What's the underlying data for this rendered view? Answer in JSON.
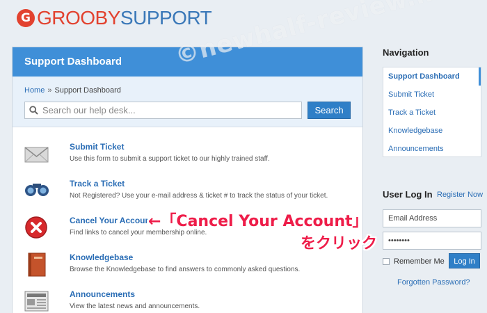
{
  "logo": {
    "grooby": "GROOBY",
    "support": "SUPPORT"
  },
  "watermark": "©newhalf-review.info",
  "panel": {
    "title": "Support Dashboard",
    "breadcrumb": {
      "home": "Home",
      "separator": "»",
      "current": "Support Dashboard"
    },
    "search": {
      "placeholder": "Search our help desk...",
      "button": "Search"
    }
  },
  "items": [
    {
      "title": "Submit Ticket",
      "desc": "Use this form to submit a support ticket to our highly trained staff.",
      "icon": "envelope-icon"
    },
    {
      "title": "Track a Ticket",
      "desc": "Not Registered? Use your e-mail address & ticket # to track the status of your ticket.",
      "icon": "binoculars-icon"
    },
    {
      "title": "Cancel Your Account",
      "desc": "Find links to cancel your membership online.",
      "icon": "cancel-icon"
    },
    {
      "title": "Knowledgebase",
      "desc": "Browse the Knowledgebase to find answers to commonly asked questions.",
      "icon": "book-icon"
    },
    {
      "title": "Announcements",
      "desc": "View the latest news and announcements.",
      "icon": "newspaper-icon"
    }
  ],
  "annotation": {
    "line1": "←「Cancel Your Account」",
    "line2": "をクリック"
  },
  "navigation": {
    "heading": "Navigation",
    "items": [
      "Support Dashboard",
      "Submit Ticket",
      "Track a Ticket",
      "Knowledgebase",
      "Announcements"
    ]
  },
  "login": {
    "heading": "User Log In",
    "register": "Register Now",
    "email_placeholder": "Email Address",
    "password_mask": "••••••••",
    "remember": "Remember Me",
    "button": "Log In",
    "forgot": "Forgotten Password?"
  },
  "colors": {
    "header": "#3f8fd8",
    "accent": "#2f7fc7",
    "brand_red": "#e2422f",
    "annotation": "#ee1d49"
  }
}
